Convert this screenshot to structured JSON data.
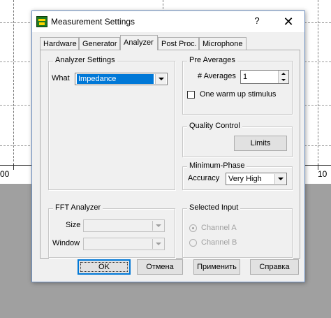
{
  "background": {
    "axis_left_label": "00",
    "axis_right_label": "10"
  },
  "dialog": {
    "title": "Measurement Settings",
    "help_label": "?",
    "close_label": "✕"
  },
  "tabs": [
    {
      "label": "Hardware"
    },
    {
      "label": "Generator"
    },
    {
      "label": "Analyzer"
    },
    {
      "label": "Post Proc."
    },
    {
      "label": "Microphone"
    }
  ],
  "analyzer_settings": {
    "title": "Analyzer Settings",
    "what_label": "What",
    "what_value": "Impedance"
  },
  "pre_averages": {
    "title": "Pre Averages",
    "averages_label": "# Averages",
    "averages_value": "1",
    "warm_up_label": "One warm up stimulus"
  },
  "quality_control": {
    "title": "Quality Control",
    "limits_label": "Limits"
  },
  "minimum_phase": {
    "title": "Minimum-Phase",
    "accuracy_label": "Accuracy",
    "accuracy_value": "Very High"
  },
  "fft_analyzer": {
    "title": "FFT Analyzer",
    "size_label": "Size",
    "window_label": "Window"
  },
  "selected_input": {
    "title": "Selected Input",
    "channel_a_label": "Channel A",
    "channel_b_label": "Channel B"
  },
  "buttons": {
    "ok": "OK",
    "cancel": "Отмена",
    "apply": "Применить",
    "help": "Справка"
  }
}
